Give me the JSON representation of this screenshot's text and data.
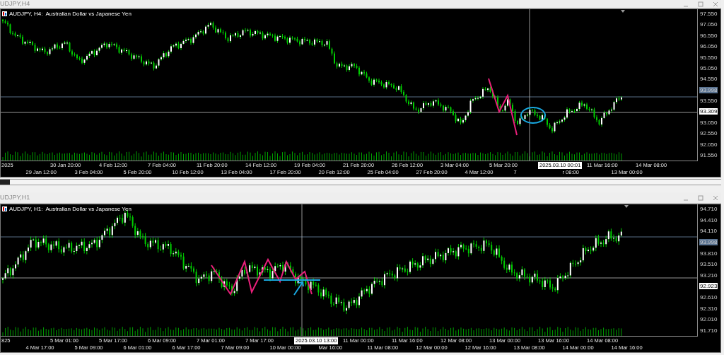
{
  "windows": [
    {
      "title": "UDJPY,H4",
      "chart_label": "AUDJPY, H4:  Australian Dollar vs Japanese Yen",
      "price_labels": [
        {
          "text": "97.550",
          "kind": "tick"
        },
        {
          "text": "97.050",
          "kind": "tick"
        },
        {
          "text": "96.550",
          "kind": "tick"
        },
        {
          "text": "96.050",
          "kind": "tick"
        },
        {
          "text": "95.550",
          "kind": "tick"
        },
        {
          "text": "95.050",
          "kind": "tick"
        },
        {
          "text": "94.550",
          "kind": "tick"
        },
        {
          "text": "93.998",
          "kind": "level"
        },
        {
          "text": "93.550",
          "kind": "tick"
        },
        {
          "text": "93.309",
          "kind": "crosshair"
        },
        {
          "text": "93.050",
          "kind": "tick"
        },
        {
          "text": "92.550",
          "kind": "tick"
        },
        {
          "text": "92.050",
          "kind": "tick"
        },
        {
          "text": "91.550",
          "kind": "tick"
        }
      ],
      "time_labels": [
        {
          "text": "2025",
          "kind": "partial"
        },
        {
          "text": "29 Jan 12:00",
          "kind": "tick"
        },
        {
          "text": "30 Jan 20:00",
          "kind": "tick"
        },
        {
          "text": "3 Feb 04:00",
          "kind": "tick"
        },
        {
          "text": "4 Feb 12:00",
          "kind": "tick"
        },
        {
          "text": "5 Feb 20:00",
          "kind": "tick"
        },
        {
          "text": "7 Feb 04:00",
          "kind": "tick"
        },
        {
          "text": "10 Feb 12:00",
          "kind": "tick"
        },
        {
          "text": "11 Feb 20:00",
          "kind": "tick"
        },
        {
          "text": "13 Feb 04:00",
          "kind": "tick"
        },
        {
          "text": "14 Feb 12:00",
          "kind": "tick"
        },
        {
          "text": "17 Feb 20:00",
          "kind": "tick"
        },
        {
          "text": "19 Feb 04:00",
          "kind": "tick"
        },
        {
          "text": "20 Feb 12:00",
          "kind": "tick"
        },
        {
          "text": "21 Feb 20:00",
          "kind": "tick"
        },
        {
          "text": "25 Feb 04:00",
          "kind": "tick"
        },
        {
          "text": "26 Feb 12:00",
          "kind": "tick"
        },
        {
          "text": "27 Feb 20:00",
          "kind": "tick"
        },
        {
          "text": "3 Mar 04:00",
          "kind": "tick"
        },
        {
          "text": "4 Mar 12:00",
          "kind": "tick"
        },
        {
          "text": "5 Mar 20:00",
          "kind": "tick"
        },
        {
          "text": "7",
          "kind": "tick"
        },
        {
          "text": "2025.03.10 00:01",
          "kind": "crosshair"
        },
        {
          "text": "r 08:00",
          "kind": "partial"
        },
        {
          "text": "11 Mar 16:00",
          "kind": "tick"
        },
        {
          "text": "13 Mar 00:00",
          "kind": "tick"
        },
        {
          "text": "14 Mar 08:00",
          "kind": "tick"
        }
      ]
    },
    {
      "title": "UDJPY,H1",
      "chart_label": "AUDJPY, H1:  Australian Dollar vs Japanese Yen",
      "price_labels": [
        {
          "text": "94.710",
          "kind": "tick"
        },
        {
          "text": "94.410",
          "kind": "tick"
        },
        {
          "text": "94.110",
          "kind": "tick"
        },
        {
          "text": "93.998",
          "kind": "level"
        },
        {
          "text": "93.810",
          "kind": "tick"
        },
        {
          "text": "93.510",
          "kind": "tick"
        },
        {
          "text": "93.210",
          "kind": "tick"
        },
        {
          "text": "92.923",
          "kind": "crosshair"
        },
        {
          "text": "92.610",
          "kind": "tick"
        },
        {
          "text": "92.310",
          "kind": "tick"
        },
        {
          "text": "92.010",
          "kind": "tick"
        },
        {
          "text": "91.710",
          "kind": "tick"
        }
      ],
      "time_labels": [
        {
          "text": "825",
          "kind": "partial"
        },
        {
          "text": "4 Mar 17:00",
          "kind": "tick"
        },
        {
          "text": "5 Mar 01:00",
          "kind": "tick"
        },
        {
          "text": "5 Mar 09:00",
          "kind": "tick"
        },
        {
          "text": "5 Mar 17:00",
          "kind": "tick"
        },
        {
          "text": "6 Mar 01:00",
          "kind": "tick"
        },
        {
          "text": "6 Mar 09:00",
          "kind": "tick"
        },
        {
          "text": "6 Mar 17:00",
          "kind": "tick"
        },
        {
          "text": "7 Mar 01:00",
          "kind": "tick"
        },
        {
          "text": "7 Mar 09:00",
          "kind": "tick"
        },
        {
          "text": "7 Mar 17:00",
          "kind": "tick"
        },
        {
          "text": "10 Mar 00:00",
          "kind": "tick"
        },
        {
          "text": "2025.03.10 13:00",
          "kind": "crosshair"
        },
        {
          "text": "Mar 16:00",
          "kind": "partial"
        },
        {
          "text": "11 Mar 00:00",
          "kind": "tick"
        },
        {
          "text": "11 Mar 08:00",
          "kind": "tick"
        },
        {
          "text": "11 Mar 16:00",
          "kind": "tick"
        },
        {
          "text": "12 Mar 00:00",
          "kind": "tick"
        },
        {
          "text": "12 Mar 08:00",
          "kind": "tick"
        },
        {
          "text": "12 Mar 16:00",
          "kind": "tick"
        },
        {
          "text": "13 Mar 00:00",
          "kind": "tick"
        },
        {
          "text": "13 Mar 08:00",
          "kind": "tick"
        },
        {
          "text": "13 Mar 16:00",
          "kind": "tick"
        },
        {
          "text": "14 Mar 00:00",
          "kind": "tick"
        },
        {
          "text": "14 Mar 08:00",
          "kind": "tick"
        },
        {
          "text": "14 Mar 16:00",
          "kind": "tick"
        }
      ]
    }
  ]
}
